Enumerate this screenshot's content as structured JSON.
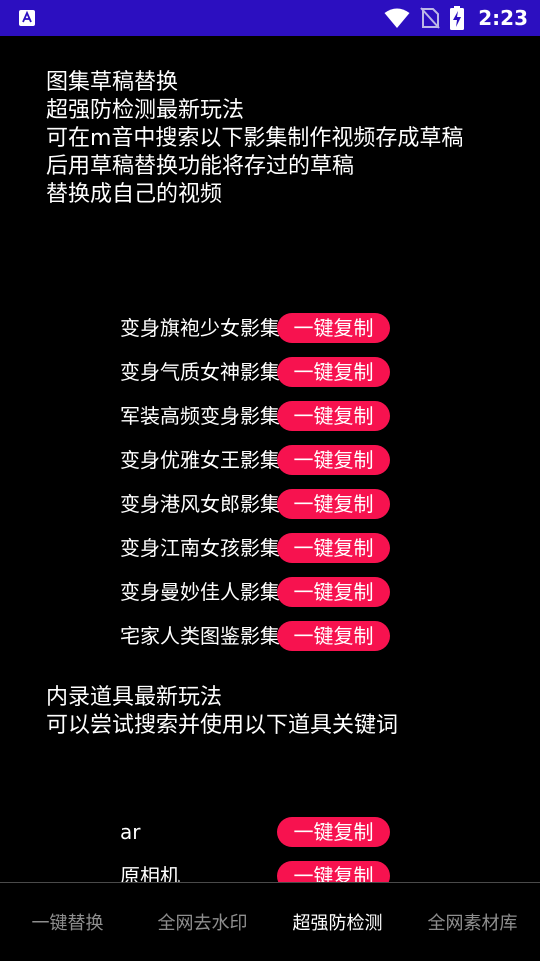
{
  "status_bar": {
    "time": "2:23",
    "bg_color": "#2c0fc0",
    "icons": [
      "app-badge-icon",
      "wifi-icon",
      "no-sim-icon",
      "battery-charging-icon"
    ]
  },
  "intro": {
    "lines": [
      "图集草稿替换",
      "超强防检测最新玩法",
      "可在m音中搜索以下影集制作视频存成草稿",
      "后用草稿替换功能将存过的草稿",
      "替换成自己的视频"
    ]
  },
  "copy_label": "一键复制",
  "accent_color": "#f7124f",
  "albums": [
    {
      "label": "变身旗袍少女影集"
    },
    {
      "label": "变身气质女神影集"
    },
    {
      "label": "军装高频变身影集"
    },
    {
      "label": "变身优雅女王影集"
    },
    {
      "label": "变身港风女郎影集"
    },
    {
      "label": "变身江南女孩影集"
    },
    {
      "label": "变身曼妙佳人影集"
    },
    {
      "label": "宅家人类图鉴影集"
    }
  ],
  "section2": {
    "lines": [
      "内录道具最新玩法",
      "可以尝试搜索并使用以下道具关键词"
    ]
  },
  "props": [
    {
      "label": "ar"
    },
    {
      "label": "原相机"
    }
  ],
  "nav": {
    "tabs": [
      {
        "label": "一键替换",
        "active": false
      },
      {
        "label": "全网去水印",
        "active": false
      },
      {
        "label": "超强防检测",
        "active": true
      },
      {
        "label": "全网素材库",
        "active": false
      }
    ]
  }
}
